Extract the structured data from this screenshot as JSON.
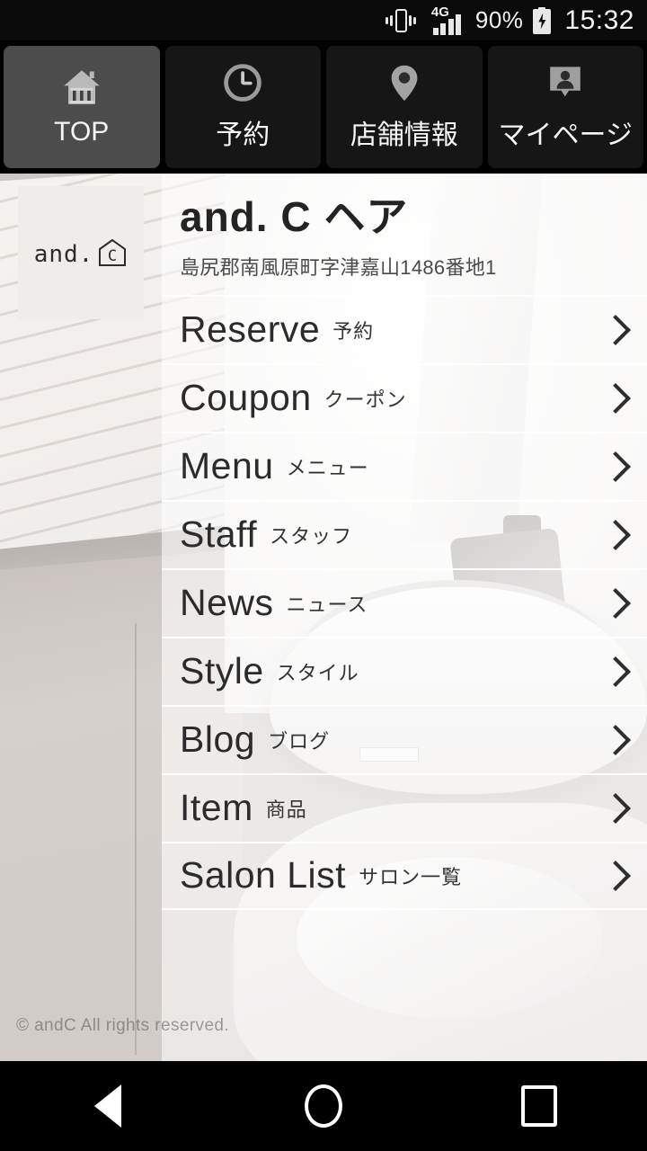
{
  "status_bar": {
    "vibrate_icon": "vibrate-icon",
    "network_type": "4G",
    "signal_icon": "signal-bars-icon",
    "battery_percent": "90%",
    "battery_icon": "battery-charging-icon",
    "clock": "15:32"
  },
  "tabs": [
    {
      "label": "TOP",
      "icon": "home-icon",
      "active": true
    },
    {
      "label": "予約",
      "icon": "clock-icon",
      "active": false
    },
    {
      "label": "店舗情報",
      "icon": "map-pin-icon",
      "active": false
    },
    {
      "label": "マイページ",
      "icon": "user-badge-icon",
      "active": false
    }
  ],
  "logo": {
    "text": "and.",
    "mark_letter": "C",
    "mark_icon": "house-outline-icon"
  },
  "salon": {
    "title": "and. C ヘア",
    "address": "島尻郡南風原町字津嘉山1486番地1"
  },
  "menu_items": [
    {
      "en": "Reserve",
      "jp": "予約"
    },
    {
      "en": "Coupon",
      "jp": "クーポン"
    },
    {
      "en": "Menu",
      "jp": "メニュー"
    },
    {
      "en": "Staff",
      "jp": "スタッフ"
    },
    {
      "en": "News",
      "jp": "ニュース"
    },
    {
      "en": "Style",
      "jp": "スタイル"
    },
    {
      "en": "Blog",
      "jp": "ブログ"
    },
    {
      "en": "Item",
      "jp": "商品"
    },
    {
      "en": "Salon List",
      "jp": "サロン一覧"
    }
  ],
  "footer": {
    "copyright": "© andC All rights reserved."
  },
  "nav_bar": {
    "back": "back-icon",
    "home": "home-circle-icon",
    "recents": "recents-square-icon"
  },
  "colors": {
    "tab_active_bg": "#4c4c4c",
    "tab_bg": "#161616",
    "text_dark": "#2b2b2b",
    "panel_overlay": "rgba(255,255,255,0.55)"
  }
}
